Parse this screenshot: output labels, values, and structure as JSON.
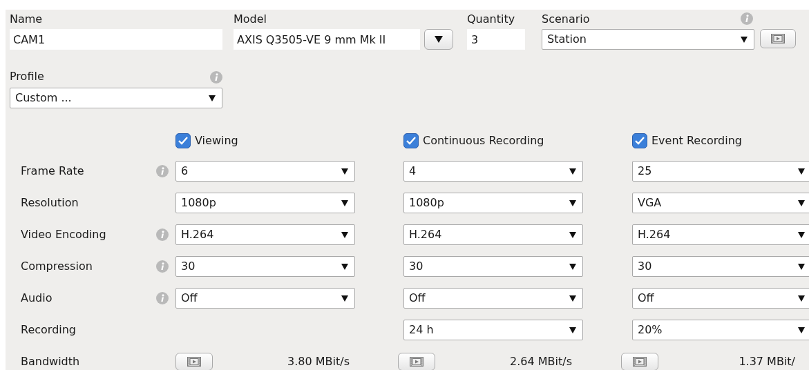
{
  "name": {
    "label": "Name",
    "value": "CAM1"
  },
  "model": {
    "label": "Model",
    "value": "AXIS Q3505-VE 9 mm Mk II"
  },
  "quantity": {
    "label": "Quantity",
    "value": "3"
  },
  "scenario": {
    "label": "Scenario",
    "value": "Station"
  },
  "profile": {
    "label": "Profile",
    "value": "Custom ..."
  },
  "columns": [
    {
      "label": "Viewing",
      "checked": true
    },
    {
      "label": "Continuous Recording",
      "checked": true
    },
    {
      "label": "Event Recording",
      "checked": true
    }
  ],
  "rows": [
    {
      "kind": "select",
      "label": "Frame Rate",
      "info": true,
      "cells": [
        "6",
        "4",
        "25"
      ]
    },
    {
      "kind": "select",
      "label": "Resolution",
      "info": false,
      "cells": [
        "1080p",
        "1080p",
        "VGA"
      ]
    },
    {
      "kind": "select",
      "label": "Video Encoding",
      "info": true,
      "cells": [
        "H.264",
        "H.264",
        "H.264"
      ]
    },
    {
      "kind": "select",
      "label": "Compression",
      "info": true,
      "cells": [
        "30",
        "30",
        "30"
      ]
    },
    {
      "kind": "select",
      "label": "Audio",
      "info": true,
      "cells": [
        "Off",
        "Off",
        "Off"
      ]
    },
    {
      "kind": "select",
      "label": "Recording",
      "info": false,
      "cells": [
        null,
        "24 h",
        "20%"
      ]
    },
    {
      "kind": "bandwidth",
      "label": "Bandwidth",
      "info": false,
      "cells": [
        "3.80 MBit/s",
        "2.64 MBit/s",
        "1.37 MBit/"
      ]
    }
  ]
}
